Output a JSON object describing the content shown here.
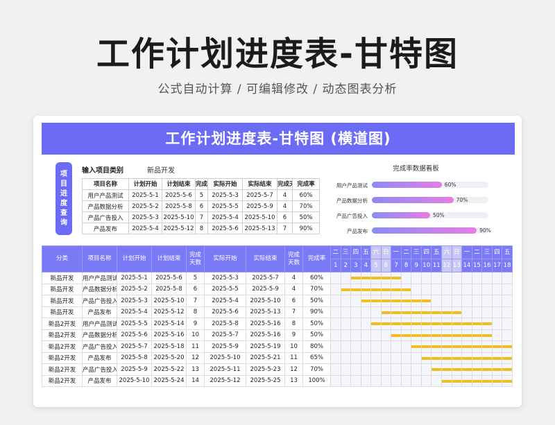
{
  "hero": {
    "title": "工作计划进度表-甘特图",
    "subtitle": "公式自动计算 /  可编辑修改  / 动态图表分析"
  },
  "sheet": {
    "title": "工作计划进度表-甘特图 (横道图)",
    "side_label": [
      "项",
      "目",
      "进",
      "度",
      "查",
      "询"
    ],
    "filter_label": "输入项目类别",
    "filter_value": "新品开发",
    "mini_headers": [
      "项目名称",
      "计划开始",
      "计划结束",
      "完成天数",
      "实际开始",
      "实际结束",
      "完成天数",
      "完成率"
    ],
    "mini_rows": [
      [
        "用户产品测试",
        "2025-5-1",
        "2025-5-6",
        "5",
        "2025-5-3",
        "2025-5-7",
        "4",
        "60%"
      ],
      [
        "产品数据分析",
        "2025-5-2",
        "2025-5-8",
        "6",
        "2025-5-5",
        "2025-5-9",
        "4",
        "70%"
      ],
      [
        "产品广告投入",
        "2025-5-3",
        "2025-5-10",
        "7",
        "2025-5-4",
        "2025-5-10",
        "6",
        "50%"
      ],
      [
        "产品发布",
        "2025-5-4",
        "2025-5-12",
        "8",
        "2025-5-6",
        "2025-5-13",
        "7",
        "90%"
      ]
    ],
    "board_title": "完成率数据看板",
    "board": [
      {
        "name": "用户产品测试",
        "pct": 0.6,
        "label": "60%"
      },
      {
        "name": "产品数据分析",
        "pct": 0.7,
        "label": "70%"
      },
      {
        "name": "产品广告投入",
        "pct": 0.5,
        "label": "50%"
      },
      {
        "name": "产品发布",
        "pct": 0.9,
        "label": "90%"
      }
    ],
    "main_headers": [
      "分类",
      "项目名称",
      "计划开始",
      "计划结束",
      "完成天数",
      "实际开始",
      "实际结束",
      "完成天数",
      "完成率"
    ],
    "weekdays": [
      "二",
      "三",
      "四",
      "五",
      "六",
      "日",
      "一",
      "二",
      "三",
      "四",
      "五",
      "六",
      "日",
      "一",
      "二",
      "三",
      "四",
      "五"
    ],
    "days": [
      "1",
      "2",
      "3",
      "4",
      "5",
      "6",
      "7",
      "8",
      "9",
      "10",
      "11",
      "12",
      "13",
      "14",
      "15",
      "16",
      "17",
      "18"
    ],
    "rows": [
      {
        "cells": [
          "新品开发",
          "用户产品测试",
          "2025-5-1",
          "2025-5-6",
          "5",
          "2025-5-3",
          "2025-5-7",
          "4",
          "60%"
        ],
        "bar": [
          3,
          7
        ]
      },
      {
        "cells": [
          "新品开发",
          "产品数据分析",
          "2025-5-2",
          "2025-5-8",
          "6",
          "2025-5-5",
          "2025-5-9",
          "4",
          "70%"
        ],
        "bar": [
          2,
          8
        ]
      },
      {
        "cells": [
          "新品开发",
          "产品广告投入",
          "2025-5-3",
          "2025-5-10",
          "7",
          "2025-5-4",
          "2025-5-10",
          "6",
          "50%"
        ],
        "bar": [
          4,
          10
        ]
      },
      {
        "cells": [
          "新品开发",
          "产品发布",
          "2025-5-4",
          "2025-5-12",
          "8",
          "2025-5-6",
          "2025-5-13",
          "7",
          "90%"
        ],
        "bar": [
          6,
          13
        ]
      },
      {
        "cells": [
          "新品2开发",
          "用户产品测试",
          "2025-5-5",
          "2025-5-14",
          "9",
          "2025-5-8",
          "2025-5-16",
          "8",
          "50%"
        ],
        "bar": [
          5,
          16
        ]
      },
      {
        "cells": [
          "新品2开发",
          "产品数据分析",
          "2025-5-6",
          "2025-5-16",
          "10",
          "2025-5-7",
          "2025-5-16",
          "9",
          "50%"
        ],
        "bar": [
          7,
          16
        ]
      },
      {
        "cells": [
          "新品2开发",
          "产品广告投入",
          "2025-5-7",
          "2025-5-18",
          "11",
          "2025-5-9",
          "2025-5-19",
          "10",
          "80%"
        ],
        "bar": [
          9,
          18
        ]
      },
      {
        "cells": [
          "新品2开发",
          "产品发布",
          "2025-5-8",
          "2025-5-20",
          "12",
          "2025-5-10",
          "2025-5-21",
          "11",
          "65%"
        ],
        "bar": [
          10,
          18
        ]
      },
      {
        "cells": [
          "新品2开发",
          "产品广告投入",
          "2025-5-9",
          "2025-5-22",
          "13",
          "2025-5-11",
          "2025-5-23",
          "12",
          "70%"
        ],
        "bar": [
          11,
          18
        ]
      },
      {
        "cells": [
          "新品2开发",
          "产品发布",
          "2025-5-10",
          "2025-5-24",
          "14",
          "2025-5-12",
          "2025-5-25",
          "13",
          "100%"
        ],
        "bar": [
          12,
          18
        ]
      }
    ]
  }
}
